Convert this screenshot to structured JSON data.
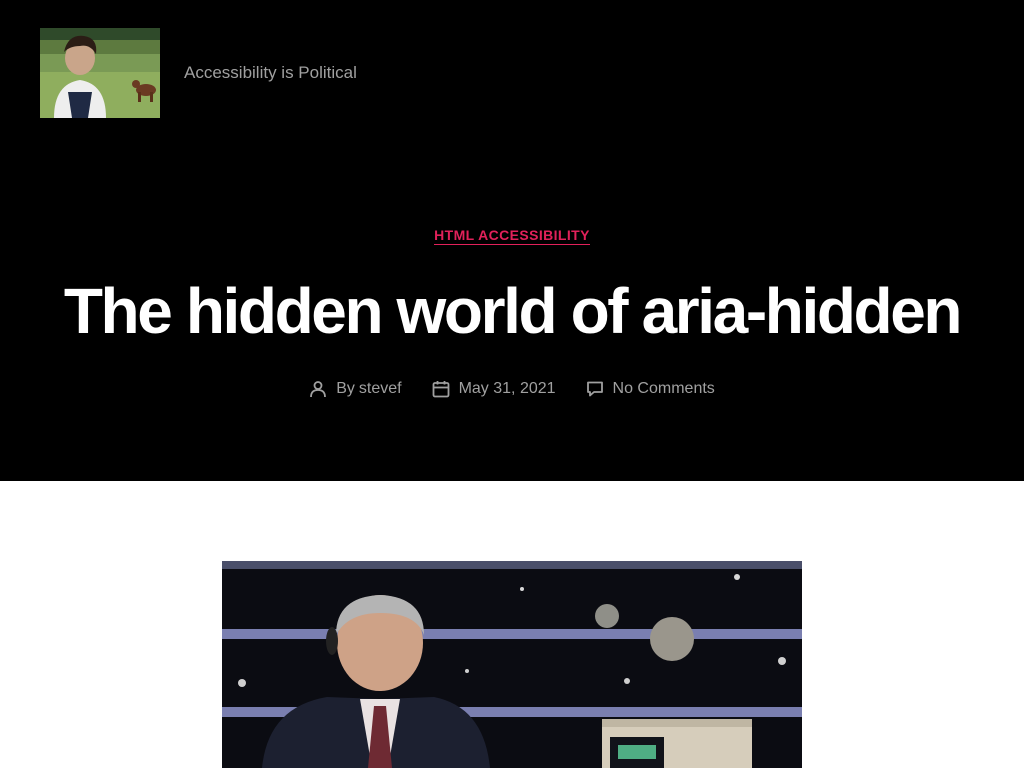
{
  "site": {
    "description": "Accessibility is Political",
    "logo_alt": "site logo"
  },
  "post": {
    "category": "HTML ACCESSIBILITY",
    "title": "The hidden world of aria-hidden",
    "meta": {
      "author_prefix": "By",
      "author": "stevef",
      "date": "May 31, 2021",
      "comments": "No Comments"
    }
  },
  "icons": {
    "author": "person-icon",
    "date": "calendar-icon",
    "comments": "speech-bubble-icon"
  },
  "colors": {
    "header_bg": "#000000",
    "accent": "#e1215a",
    "title": "#ffffff",
    "meta_text": "#a0a0a0",
    "page_bg": "#ffffff"
  }
}
